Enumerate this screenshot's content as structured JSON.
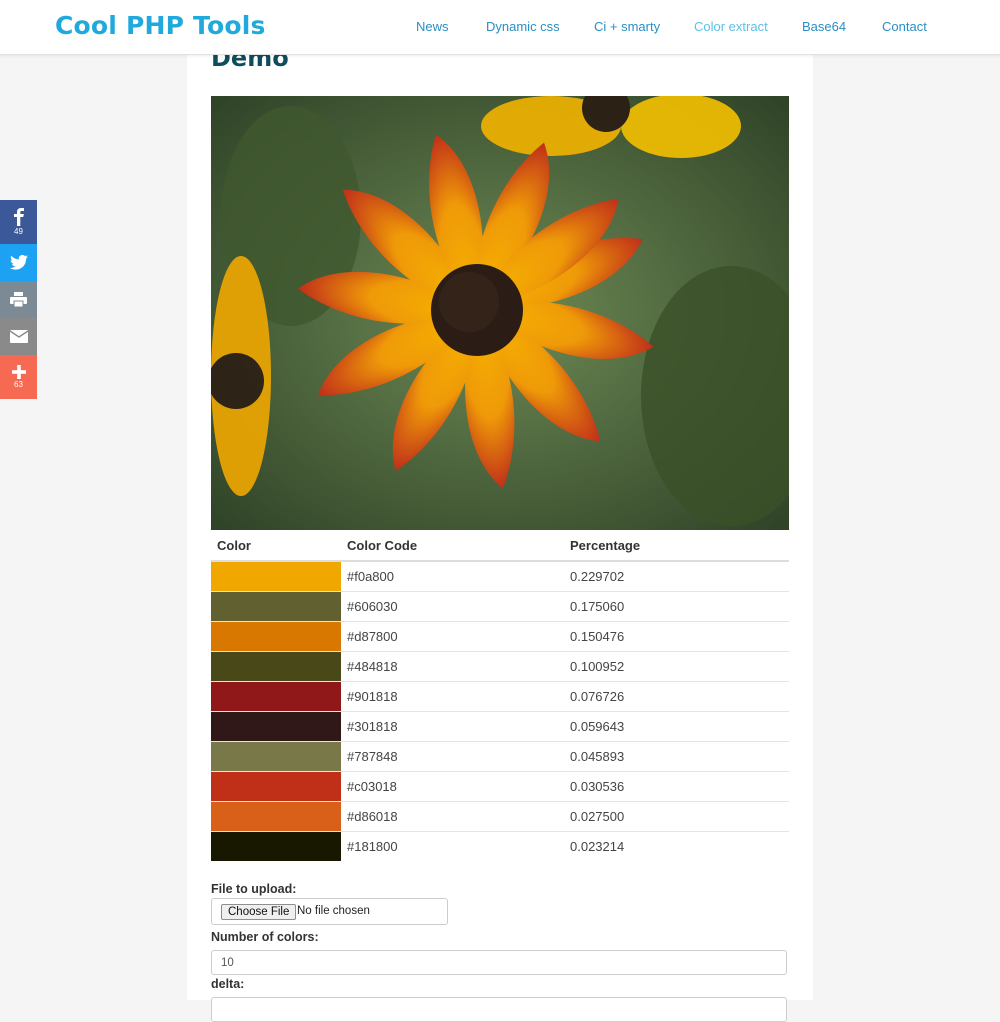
{
  "header": {
    "brand": "Cool PHP Tools",
    "nav": [
      {
        "label": "News",
        "active": false
      },
      {
        "label": "Dynamic css",
        "active": false
      },
      {
        "label": "Ci + smarty",
        "active": false
      },
      {
        "label": "Color extract",
        "active": true
      },
      {
        "label": "Base64",
        "active": false
      },
      {
        "label": "Contact",
        "active": false
      }
    ]
  },
  "share": {
    "facebook": {
      "icon": "facebook-icon",
      "count": "49"
    },
    "twitter": {
      "icon": "twitter-icon"
    },
    "print": {
      "icon": "print-icon"
    },
    "email": {
      "icon": "email-icon"
    },
    "more": {
      "icon": "plus-icon",
      "count": "63"
    }
  },
  "main": {
    "title": "Demo",
    "table": {
      "headers": [
        "Color",
        "Color Code",
        "Percentage"
      ],
      "rows": [
        {
          "color": "#f0a800",
          "code": "#f0a800",
          "percentage": "0.229702"
        },
        {
          "color": "#606030",
          "code": "#606030",
          "percentage": "0.175060"
        },
        {
          "color": "#d87800",
          "code": "#d87800",
          "percentage": "0.150476"
        },
        {
          "color": "#484818",
          "code": "#484818",
          "percentage": "0.100952"
        },
        {
          "color": "#901818",
          "code": "#901818",
          "percentage": "0.076726"
        },
        {
          "color": "#301818",
          "code": "#301818",
          "percentage": "0.059643"
        },
        {
          "color": "#787848",
          "code": "#787848",
          "percentage": "0.045893"
        },
        {
          "color": "#c03018",
          "code": "#c03018",
          "percentage": "0.030536"
        },
        {
          "color": "#d86018",
          "code": "#d86018",
          "percentage": "0.027500"
        },
        {
          "color": "#181800",
          "code": "#181800",
          "percentage": "0.023214"
        }
      ]
    },
    "form": {
      "file_label": "File to upload:",
      "file_button": "Choose File",
      "file_status": "No file chosen",
      "colors_label": "Number of colors:",
      "colors_value": "10",
      "delta_label": "delta:"
    }
  }
}
